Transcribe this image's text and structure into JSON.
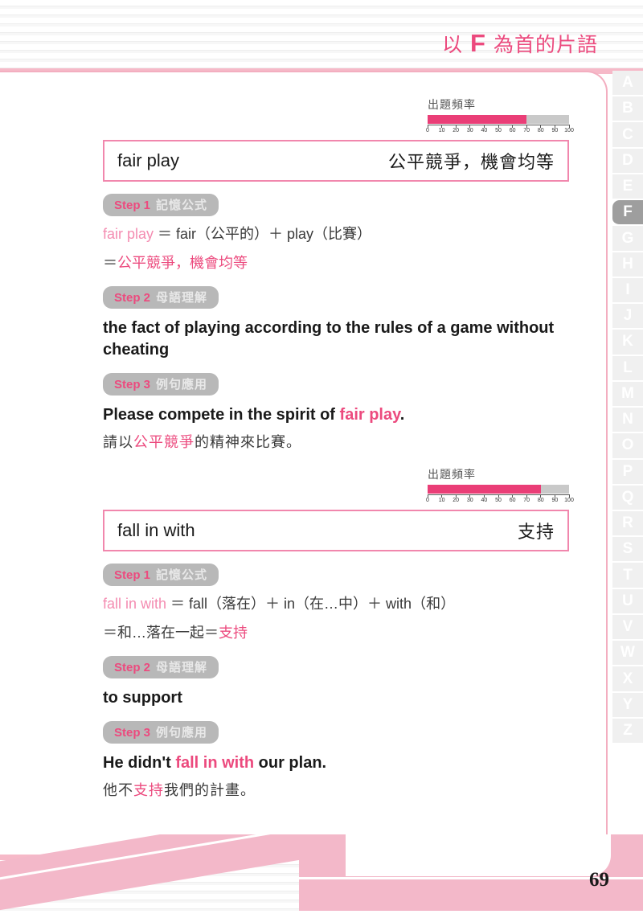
{
  "header": {
    "prefix": "以",
    "letter": "F",
    "suffix": "為首的片語"
  },
  "page_number": "69",
  "alphabet_index": {
    "letters": [
      "A",
      "B",
      "C",
      "D",
      "E",
      "F",
      "G",
      "H",
      "I",
      "J",
      "K",
      "L",
      "M",
      "N",
      "O",
      "P",
      "Q",
      "R",
      "S",
      "T",
      "U",
      "V",
      "W",
      "X",
      "Y",
      "Z"
    ],
    "active": "F"
  },
  "frequency": {
    "label": "出題頻率",
    "ticks": [
      "0",
      "10",
      "20",
      "30",
      "40",
      "50",
      "60",
      "70",
      "80",
      "90",
      "100"
    ]
  },
  "steps": {
    "s1_n": "Step 1",
    "s1_zh": "記憶公式",
    "s2_n": "Step 2",
    "s2_zh": "母語理解",
    "s3_n": "Step 3",
    "s3_zh": "例句應用"
  },
  "colors": {
    "accent_pink": "#ec4a7e",
    "light_pink": "#f3b8c9",
    "soft_pink": "#f187ad",
    "badge_gray": "#b8b8b8",
    "index_gray": "#f0f0f0",
    "index_active": "#9e9e9e"
  },
  "entries": [
    {
      "term": "fair play",
      "meaning": "公平競爭，機會均等",
      "frequency_value": 70,
      "formula_term": "fair play",
      "formula_rest": " ＝ fair（公平的）＋ play（比賽）",
      "formula_result_prefix": "＝",
      "formula_result": "公平競爭，機會均等",
      "definition": "the fact of playing according to the rules of a game without cheating",
      "example_en_pre": "Please compete in the spirit of ",
      "example_en_term": "fair play",
      "example_en_post": ".",
      "example_zh_pre": "請以",
      "example_zh_term": "公平競爭",
      "example_zh_post": "的精神來比賽。"
    },
    {
      "term": "fall in with",
      "meaning": "支持",
      "frequency_value": 80,
      "formula_term": "fall in with",
      "formula_rest": " ＝ fall（落在）＋ in（在…中）＋ with（和）",
      "formula_result_prefix": "＝和…落在一起＝",
      "formula_result": "支持",
      "definition": "to support",
      "example_en_pre": "He didn't ",
      "example_en_term": "fall in with",
      "example_en_post": " our plan.",
      "example_zh_pre": "他不",
      "example_zh_term": "支持",
      "example_zh_post": "我們的計畫。"
    }
  ]
}
